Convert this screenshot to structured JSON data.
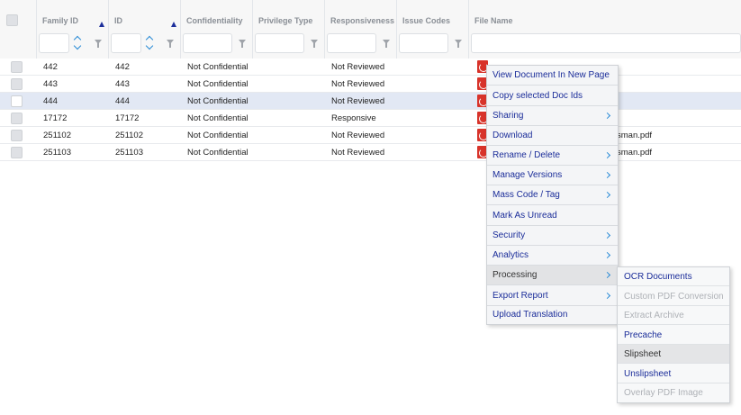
{
  "grid": {
    "columns": [
      {
        "key": "family_id",
        "label": "Family ID"
      },
      {
        "key": "id",
        "label": "ID"
      },
      {
        "key": "confidentiality",
        "label": "Confidentiality"
      },
      {
        "key": "privilege_type",
        "label": "Privilege Type"
      },
      {
        "key": "responsiveness",
        "label": "Responsiveness"
      },
      {
        "key": "issue_codes",
        "label": "Issue Codes"
      },
      {
        "key": "file_name",
        "label": "File Name"
      }
    ],
    "rows": [
      {
        "family_id": "442",
        "id": "442",
        "confidentiality": "Not Confidential",
        "privilege_type": "",
        "responsiveness": "Not Reviewed",
        "file_name": "",
        "selected": false
      },
      {
        "family_id": "443",
        "id": "443",
        "confidentiality": "Not Confidential",
        "privilege_type": "",
        "responsiveness": "Not Reviewed",
        "file_name": "",
        "selected": false
      },
      {
        "family_id": "444",
        "id": "444",
        "confidentiality": "Not Confidential",
        "privilege_type": "",
        "responsiveness": "Not Reviewed",
        "file_name": "",
        "selected": true
      },
      {
        "family_id": "17172",
        "id": "17172",
        "confidentiality": "Not Confidential",
        "privilege_type": "",
        "responsiveness": "Responsive",
        "file_name": "",
        "selected": false
      },
      {
        "family_id": "251102",
        "id": "251102",
        "confidentiality": "Not Confidential",
        "privilege_type": "",
        "responsiveness": "Not Reviewed",
        "file_name": "sman.pdf",
        "selected": false
      },
      {
        "family_id": "251103",
        "id": "251103",
        "confidentiality": "Not Confidential",
        "privilege_type": "",
        "responsiveness": "Not Reviewed",
        "file_name": "sman.pdf",
        "selected": false
      }
    ]
  },
  "context_menu": {
    "items": [
      {
        "label": "View Document In New Page",
        "submenu": false
      },
      {
        "label": "Copy selected Doc Ids",
        "submenu": false
      },
      {
        "label": "Sharing",
        "submenu": true
      },
      {
        "label": "Download",
        "submenu": false
      },
      {
        "label": "Rename / Delete",
        "submenu": true
      },
      {
        "label": "Manage Versions",
        "submenu": true
      },
      {
        "label": "Mass Code / Tag",
        "submenu": true
      },
      {
        "label": "Mark As Unread",
        "submenu": false
      },
      {
        "label": "Security",
        "submenu": true
      },
      {
        "label": "Analytics",
        "submenu": true
      },
      {
        "label": "Processing",
        "submenu": true,
        "active": true
      },
      {
        "label": "Export Report",
        "submenu": true
      },
      {
        "label": "Upload Translation",
        "submenu": false
      }
    ]
  },
  "processing_submenu": {
    "items": [
      {
        "label": "OCR Documents",
        "enabled": true
      },
      {
        "label": "Custom PDF Conversion",
        "enabled": false
      },
      {
        "label": "Extract Archive",
        "enabled": false
      },
      {
        "label": "Precache",
        "enabled": true
      },
      {
        "label": "Slipsheet",
        "enabled": true,
        "hover": true
      },
      {
        "label": "Unslipsheet",
        "enabled": true
      },
      {
        "label": "Overlay PDF Image",
        "enabled": false
      }
    ]
  },
  "colors": {
    "menu_text": "#1a2c99",
    "disabled_text": "#aeb1b6",
    "selected_row": "#e2e8f4",
    "pdf_icon": "#d8332a",
    "sort_arrow": "#1d2f9b"
  }
}
